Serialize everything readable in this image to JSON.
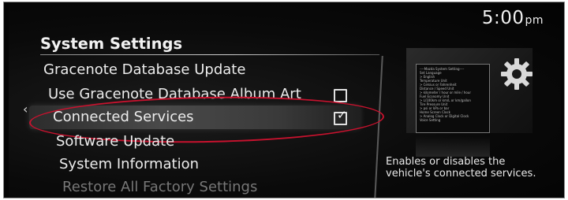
{
  "status_bar": {
    "time": "5:00",
    "time_suffix": "pm"
  },
  "page": {
    "title": "System Settings"
  },
  "menu": {
    "items": [
      {
        "label": "Gracenote Database Update"
      },
      {
        "label": "Use Gracenote Database Album Art",
        "checked": false
      },
      {
        "label": "Connected Services",
        "checked": true
      },
      {
        "label": "Software Update"
      },
      {
        "label": "System Information"
      },
      {
        "label": "Restore All Factory Settings"
      }
    ]
  },
  "preview": {
    "lines": [
      "----Mazda System Setting----",
      "Set Language",
      "> English",
      "Temperature Unit",
      "> Celsius or Fahrenheit",
      "Distance / Speed Unit",
      "> kilometer / hour or mile / hour",
      "Fuel Economy Unit",
      "> L/100km or km/L or km/gallon",
      "Tire Pressure Unit",
      "> psi or kPa or bar",
      "Home Screen Clock",
      "> Analog Clock or Digital Clock",
      "Voice Setting"
    ],
    "gear_icon": "gear-icon"
  },
  "description": "Enables or disables the vehicle's connected services.",
  "colors": {
    "highlight_oval": "#c8122e",
    "background": "#050505",
    "text": "#ececec"
  }
}
